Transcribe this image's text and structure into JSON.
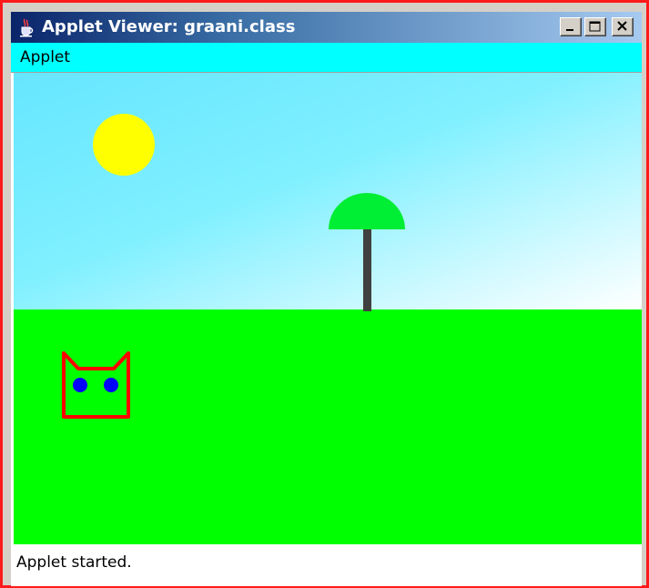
{
  "window": {
    "title": "Applet Viewer: graani.class",
    "title_icon": "java-cup-icon",
    "controls": {
      "minimize_icon": "minimize-icon",
      "maximize_icon": "maximize-icon",
      "close_icon": "close-icon"
    },
    "frame_color": "#ff1a1a"
  },
  "menubar": {
    "items": [
      {
        "label": "Applet"
      }
    ],
    "background": "#00ffff"
  },
  "scene": {
    "sky_gradient": [
      "#66e6ff",
      "#ffffff"
    ],
    "ground_color": "#00ff00",
    "sun_color": "#ffff00",
    "tree": {
      "canopy_color": "#00ee33",
      "trunk_color": "#404040"
    },
    "cat": {
      "outline_color": "#ff0000",
      "eye_color": "#0000ff"
    }
  },
  "statusbar": {
    "text": "Applet started."
  }
}
